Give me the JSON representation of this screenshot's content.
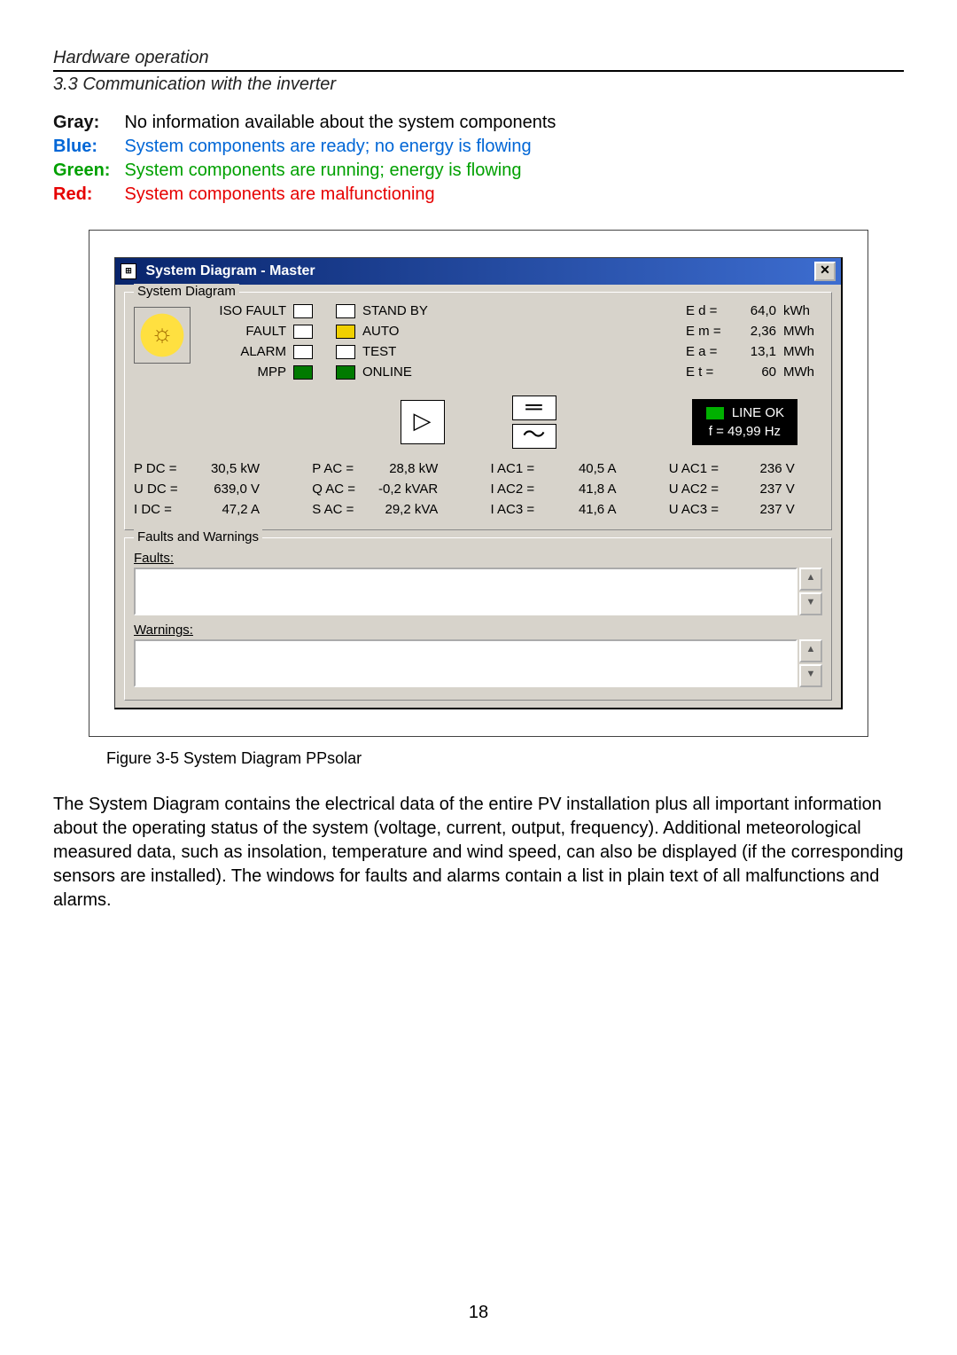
{
  "header": {
    "title": "Hardware operation",
    "subtitle": "3.3 Communication with the inverter"
  },
  "legend": {
    "gray": {
      "key": "Gray:",
      "text": "No information available about the system components"
    },
    "blue": {
      "key": "Blue:",
      "text": "System components are ready; no energy is flowing"
    },
    "green": {
      "key": "Green:",
      "text": "System components are running; energy is flowing"
    },
    "red": {
      "key": "Red:",
      "text": "System components are malfunctioning"
    }
  },
  "window": {
    "title": "System Diagram - Master",
    "close": "✕",
    "group_system": "System Diagram",
    "group_faults": "Faults and Warnings",
    "status": {
      "left": [
        "ISO FAULT",
        "FAULT",
        "ALARM",
        "MPP"
      ],
      "right": [
        "STAND BY",
        "AUTO",
        "TEST",
        "ONLINE"
      ]
    },
    "energy": [
      {
        "lab": "E d =",
        "val": "64,0",
        "unit": "kWh"
      },
      {
        "lab": "E m =",
        "val": "2,36",
        "unit": "MWh"
      },
      {
        "lab": "E a =",
        "val": "13,1",
        "unit": "MWh"
      },
      {
        "lab": "E t =",
        "val": "60",
        "unit": "MWh"
      }
    ],
    "line": {
      "ok": "LINE OK",
      "freq": "f = 49,99 Hz"
    },
    "inbox": "▷",
    "dcbox": "═",
    "acbox": "〜",
    "meas": [
      {
        "lab": "P DC =",
        "val": "30,5 kW"
      },
      {
        "lab": "P AC =",
        "val": "28,8 kW"
      },
      {
        "lab": "I AC1 =",
        "val": "40,5 A"
      },
      {
        "lab": "U AC1 =",
        "val": "236 V"
      },
      {
        "lab": "U DC =",
        "val": "639,0 V"
      },
      {
        "lab": "Q AC =",
        "val": "-0,2 kVAR"
      },
      {
        "lab": "I AC2 =",
        "val": "41,8 A"
      },
      {
        "lab": "U AC2 =",
        "val": "237 V"
      },
      {
        "lab": "I DC =",
        "val": "47,2 A"
      },
      {
        "lab": "S AC =",
        "val": "29,2 kVA"
      },
      {
        "lab": "I AC3 =",
        "val": "41,6 A"
      },
      {
        "lab": "U AC3 =",
        "val": "237 V"
      }
    ],
    "faults_label": "Faults:",
    "warnings_label": "Warnings:",
    "arrow_up": "▲",
    "arrow_down": "▼"
  },
  "caption": "Figure 3-5 System Diagram PPsolar",
  "body": "The System Diagram contains the electrical data of the entire PV installation plus all important information about the operating status of the system (voltage, current, output, frequency). Additional meteorological measured data, such as insolation, temperature and wind speed, can also be displayed (if the corresponding sensors are installed). The windows for faults and alarms contain a list in plain text of all malfunctions and alarms.",
  "page_number": "18"
}
